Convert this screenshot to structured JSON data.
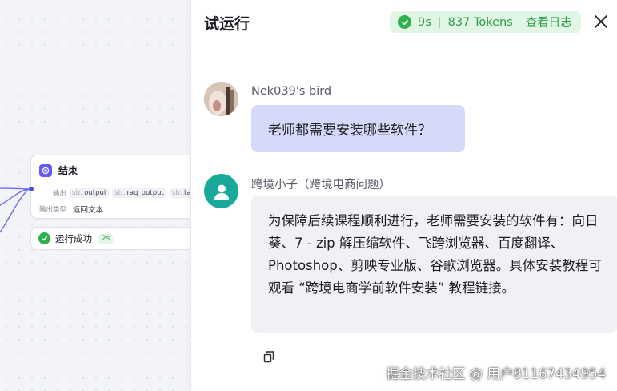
{
  "canvas": {
    "node": {
      "title": "结束",
      "output_label": "输出",
      "outputs": [
        {
          "prefix": "str.",
          "name": "output"
        },
        {
          "prefix": "str.",
          "name": "rag_output"
        },
        {
          "prefix": "str.",
          "name": "tal"
        }
      ],
      "type_label": "输出类型",
      "type_value": "返回文本"
    },
    "status": {
      "text": "运行成功",
      "time": "2s"
    }
  },
  "panel": {
    "title": "试运行",
    "badge": {
      "duration": "9s",
      "separator": "|",
      "tokens": "837 Tokens",
      "log_link": "查看日志"
    },
    "messages": {
      "user": {
        "name": "Nek039's bird",
        "text": "老师都需要安装哪些软件？"
      },
      "bot": {
        "name": "跨境小子（跨境电商问题）",
        "text": "为保障后续课程顺利进行，老师需要安装的软件有：向日葵、7 - zip 解压缩软件、飞跨浏览器、百度翻译、Photoshop、剪映专业版、谷歌浏览器。具体安装教程可观看 “跨境电商学前软件安装” 教程链接。"
      }
    }
  },
  "watermark": "掘金技术社区 @ 用户81167434954",
  "colors": {
    "accent": "#6559f0",
    "success": "#2fb24c",
    "user_bubble": "#d6d9f8",
    "bot_bubble": "#f0f1f4"
  },
  "icons": [
    "end-node-icon",
    "check-circle-icon",
    "close-icon",
    "robot-user-icon",
    "copy-icon"
  ]
}
